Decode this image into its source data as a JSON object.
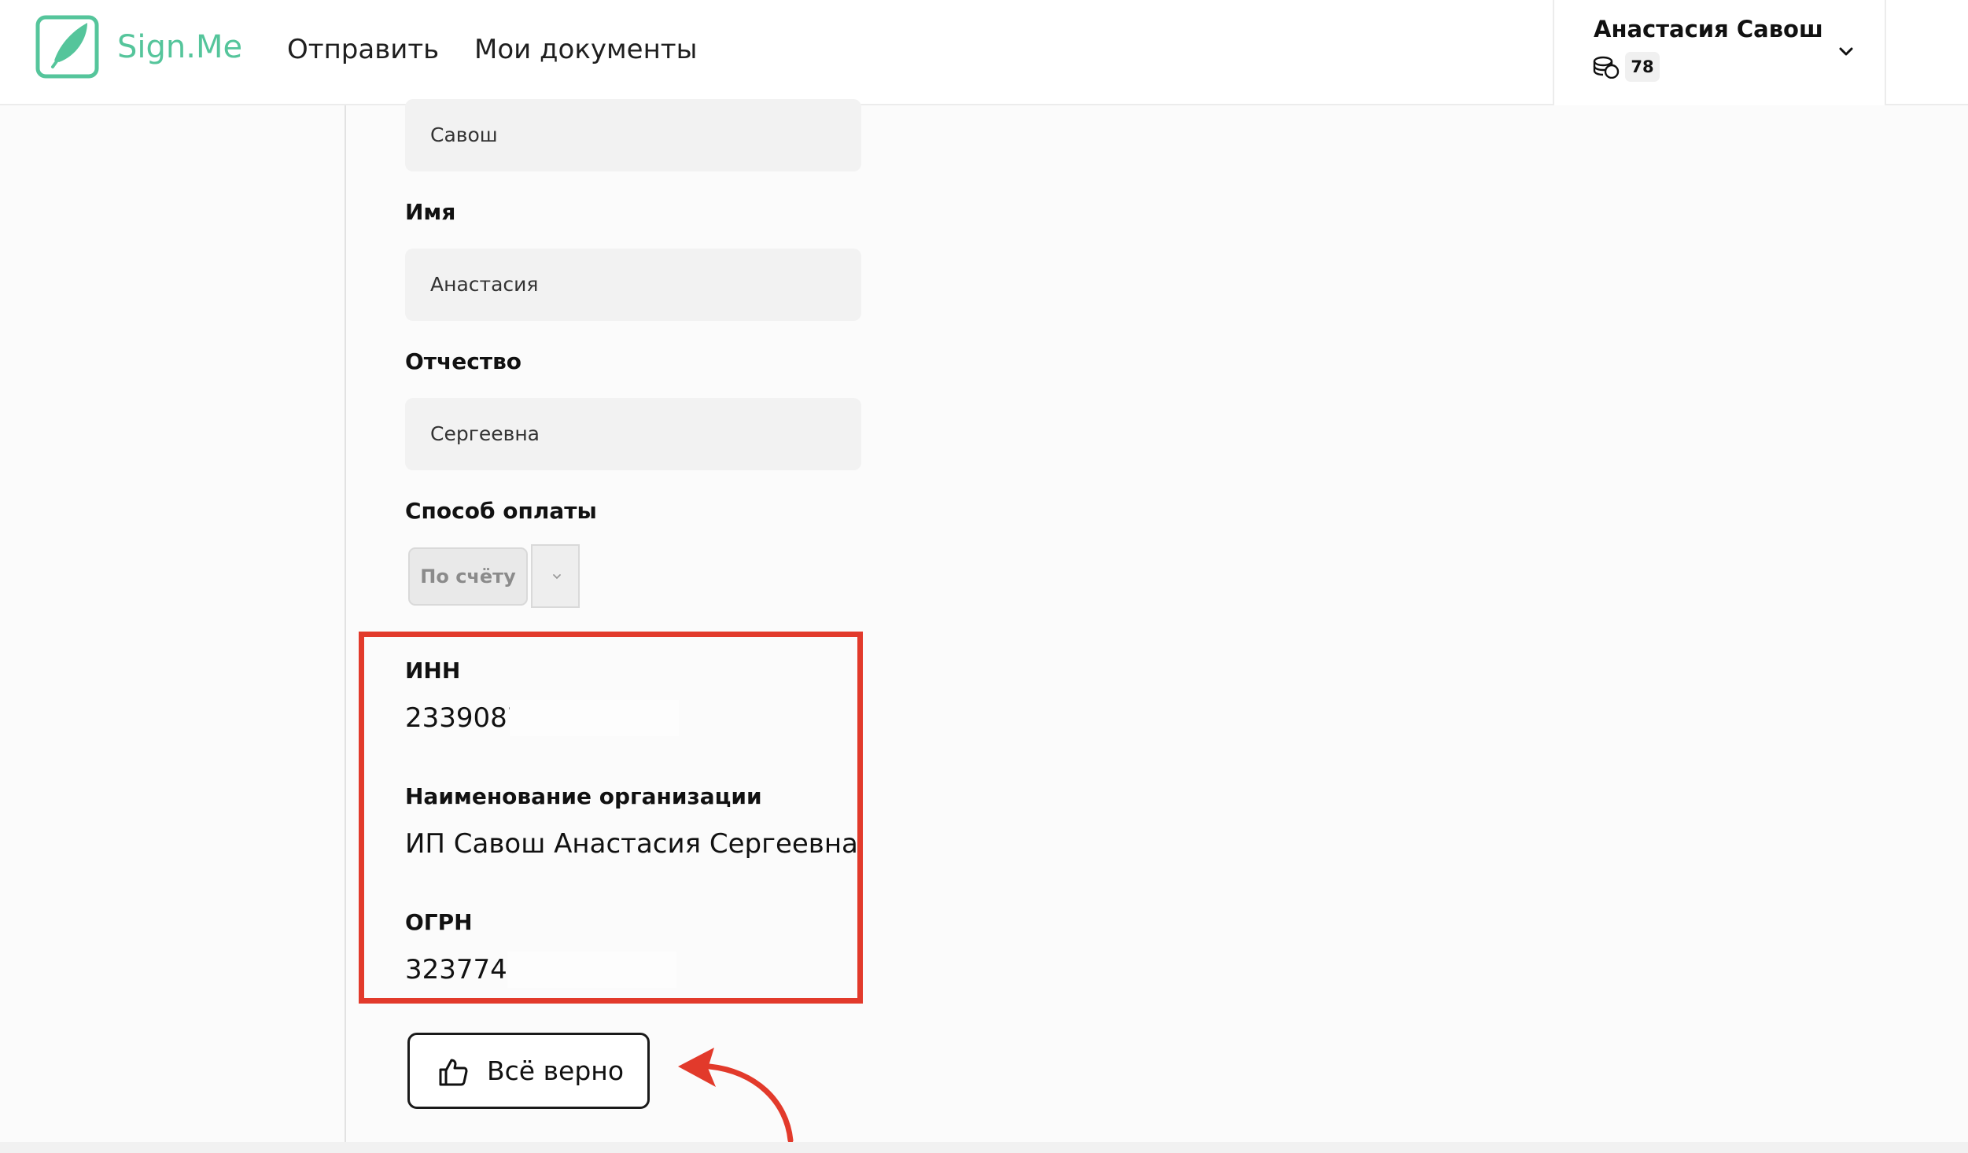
{
  "header": {
    "logo_text": "Sign.Me",
    "nav": {
      "send": "Отправить",
      "documents": "Мои документы"
    },
    "user": {
      "name": "Анастасия Савош",
      "balance": "78"
    }
  },
  "form": {
    "surname": {
      "value": "Савош"
    },
    "first_name": {
      "label": "Имя",
      "value": "Анастасия"
    },
    "patronymic": {
      "label": "Отчество",
      "value": "Сергеевна"
    },
    "payment": {
      "label": "Способ оплаты",
      "selected": "По счёту"
    }
  },
  "organization": {
    "inn": {
      "label": "ИНН",
      "value": "2339087"
    },
    "name": {
      "label": "Наименование организации",
      "value": "ИП Савош Анастасия Сергеевна"
    },
    "ogrn": {
      "label": "ОГРН",
      "value": "3237746"
    }
  },
  "actions": {
    "confirm_label": "Всё верно"
  },
  "colors": {
    "brand": "#55c59b",
    "highlight": "#e23a2b"
  }
}
